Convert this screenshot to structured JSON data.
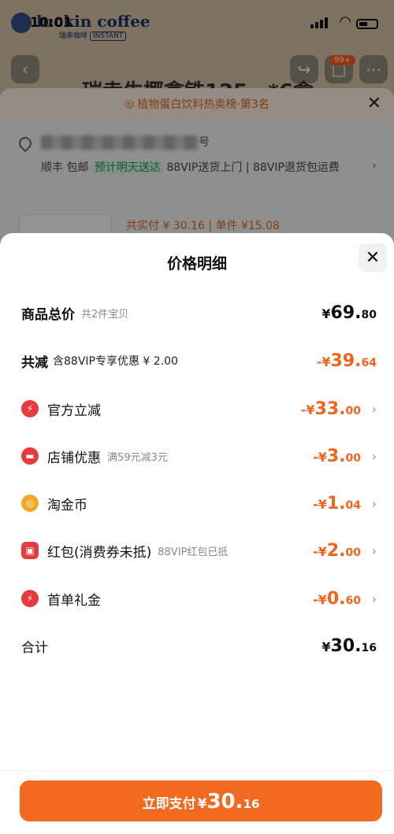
{
  "status_bar": {
    "time": "10:01",
    "brand": "luckin coffee",
    "brand_sub": "瑞幸咖啡",
    "brand_tag": "INSTANT"
  },
  "background": {
    "product_title": "瑞幸生椰拿铁125一*6盒",
    "cart_badge": "99+",
    "rank_text": "植物蛋白饮料热卖榜·第3名",
    "address_tail": "号",
    "shipping": {
      "carrier": "顺丰 包邮",
      "eta": "预计明天送达",
      "extras": "88VIP送货上门 | 88VIP退货包运费"
    },
    "price_summary": "共实付 ¥ 30.16 | 单件 ¥15.08"
  },
  "sheet": {
    "title": "价格明细",
    "rows": [
      {
        "label": "商品总价",
        "note": "共2件宝贝",
        "symbol": "¥",
        "int": "69.",
        "dec": "80"
      },
      {
        "label": "共减",
        "note": "含88VIP专享优惠 ¥ 2.00",
        "symbol": "-¥",
        "int": "39.",
        "dec": "64"
      },
      {
        "label": "官方立减",
        "note": "",
        "symbol": "-¥",
        "int": "33.",
        "dec": "00",
        "icon": "lightning-icon",
        "icon_color": "#e8393c"
      },
      {
        "label": "店铺优惠",
        "note": "满59元减3元",
        "symbol": "-¥",
        "int": "3.",
        "dec": "00",
        "icon": "shop-icon",
        "icon_color": "#e8393c"
      },
      {
        "label": "淘金币",
        "note": "",
        "symbol": "-¥",
        "int": "1.",
        "dec": "04",
        "icon": "coin-icon",
        "icon_color": "#f5a623"
      },
      {
        "label": "红包(消费券未抵)",
        "note": "88VIP红包已抵",
        "symbol": "-¥",
        "int": "2.",
        "dec": "00",
        "icon": "red-packet-icon",
        "icon_color": "#e8393c"
      },
      {
        "label": "首单礼金",
        "note": "",
        "symbol": "-¥",
        "int": "0.",
        "dec": "60",
        "icon": "lightning-icon",
        "icon_color": "#e8393c"
      },
      {
        "label": "合计",
        "note": "",
        "symbol": "¥",
        "int": "30.",
        "dec": "16"
      }
    ],
    "pay_button": {
      "label": "立即支付",
      "symbol": "¥",
      "int": "30.",
      "dec": "16"
    }
  },
  "colors": {
    "accent": "#f26a1f",
    "discount": "#f0641e",
    "green_tag": "#18a058"
  }
}
